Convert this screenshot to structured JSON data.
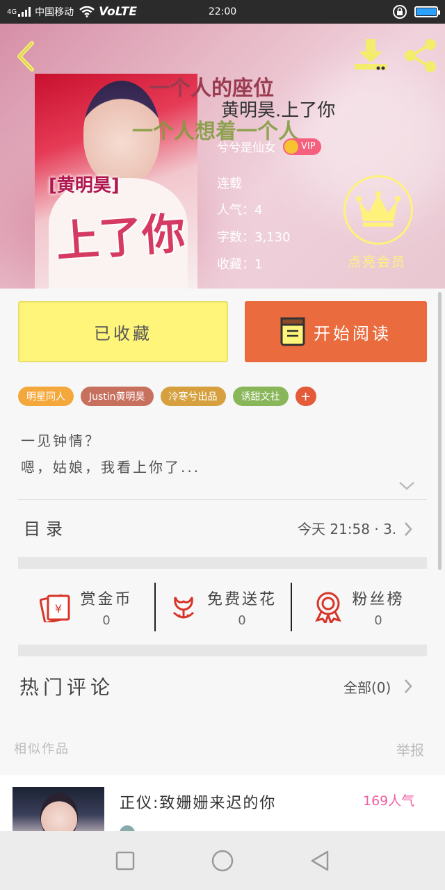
{
  "status_bar": {
    "network": "4G",
    "carrier": "中国移动",
    "volte": "VoLTE",
    "time": "22:00"
  },
  "hero": {
    "deco_line1": "一个人的座位",
    "deco_line2": "一个人想着一个人",
    "title": "黄明昊.上了你",
    "author": "兮兮是仙女",
    "vip": "VIP",
    "status": "连载",
    "popularity": "人气：4",
    "word_count": "字数：3,130",
    "favorites": "收藏：1",
    "member_label": "点亮会员",
    "cover_tag": "[黄明昊]",
    "cover_big": "上了你"
  },
  "actions": {
    "favorited_label": "已收藏",
    "read_label": "开始阅读"
  },
  "tags": [
    {
      "label": "明星同人",
      "color": "#f4a73a"
    },
    {
      "label": "Justin黄明昊",
      "color": "#c8705e"
    },
    {
      "label": "冷寒兮出品",
      "color": "#d6a03e"
    },
    {
      "label": "诱甜文社",
      "color": "#8ab65a"
    }
  ],
  "tag_add": "+",
  "synopsis": {
    "line1": "一见钟情？",
    "line2": "嗯，姑娘，我看上你了..."
  },
  "toc": {
    "label": "目录",
    "update": "今天 21:58 · 3."
  },
  "rewards": [
    {
      "name": "赏金币",
      "value": "0",
      "icon": "red-envelope-icon"
    },
    {
      "name": "免费送花",
      "value": "0",
      "icon": "flower-icon"
    },
    {
      "name": "粉丝榜",
      "value": "0",
      "icon": "medal-icon"
    }
  ],
  "comments": {
    "label": "热门评论",
    "all": "全部(0)"
  },
  "similar": {
    "label": "相似作品",
    "report": "举报",
    "items": [
      {
        "title": "正仪:致姗姗来迟的你",
        "popularity": "169人气"
      }
    ]
  },
  "colors": {
    "fav_button": "#fef57a",
    "read_button": "#ea6b3e",
    "member_gold": "#fff27a"
  }
}
